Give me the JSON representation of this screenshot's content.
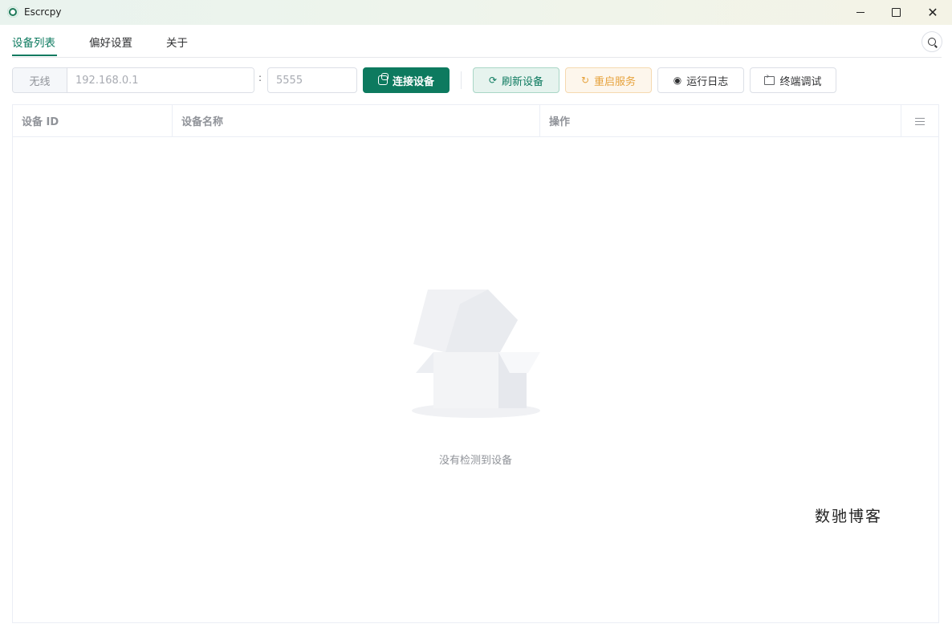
{
  "window": {
    "title": "Escrcpy",
    "icon": "app-logo-icon"
  },
  "tabs": [
    {
      "label": "设备列表",
      "active": true
    },
    {
      "label": "偏好设置",
      "active": false
    },
    {
      "label": "关于",
      "active": false
    }
  ],
  "toolbar": {
    "prefix_label": "无线",
    "ip_placeholder": "192.168.0.1",
    "colon": ":",
    "port_placeholder": "5555",
    "buttons": {
      "connect": "连接设备",
      "refresh": "刷新设备",
      "restart": "重启服务",
      "logs": "运行日志",
      "terminal": "终端调试"
    }
  },
  "table": {
    "columns": [
      "设备 ID",
      "设备名称",
      "操作"
    ],
    "empty_text": "没有检测到设备"
  },
  "watermark": "数驰博客",
  "colors": {
    "primary": "#0d7a5f",
    "warning": "#e6a23c",
    "muted": "#909399"
  }
}
